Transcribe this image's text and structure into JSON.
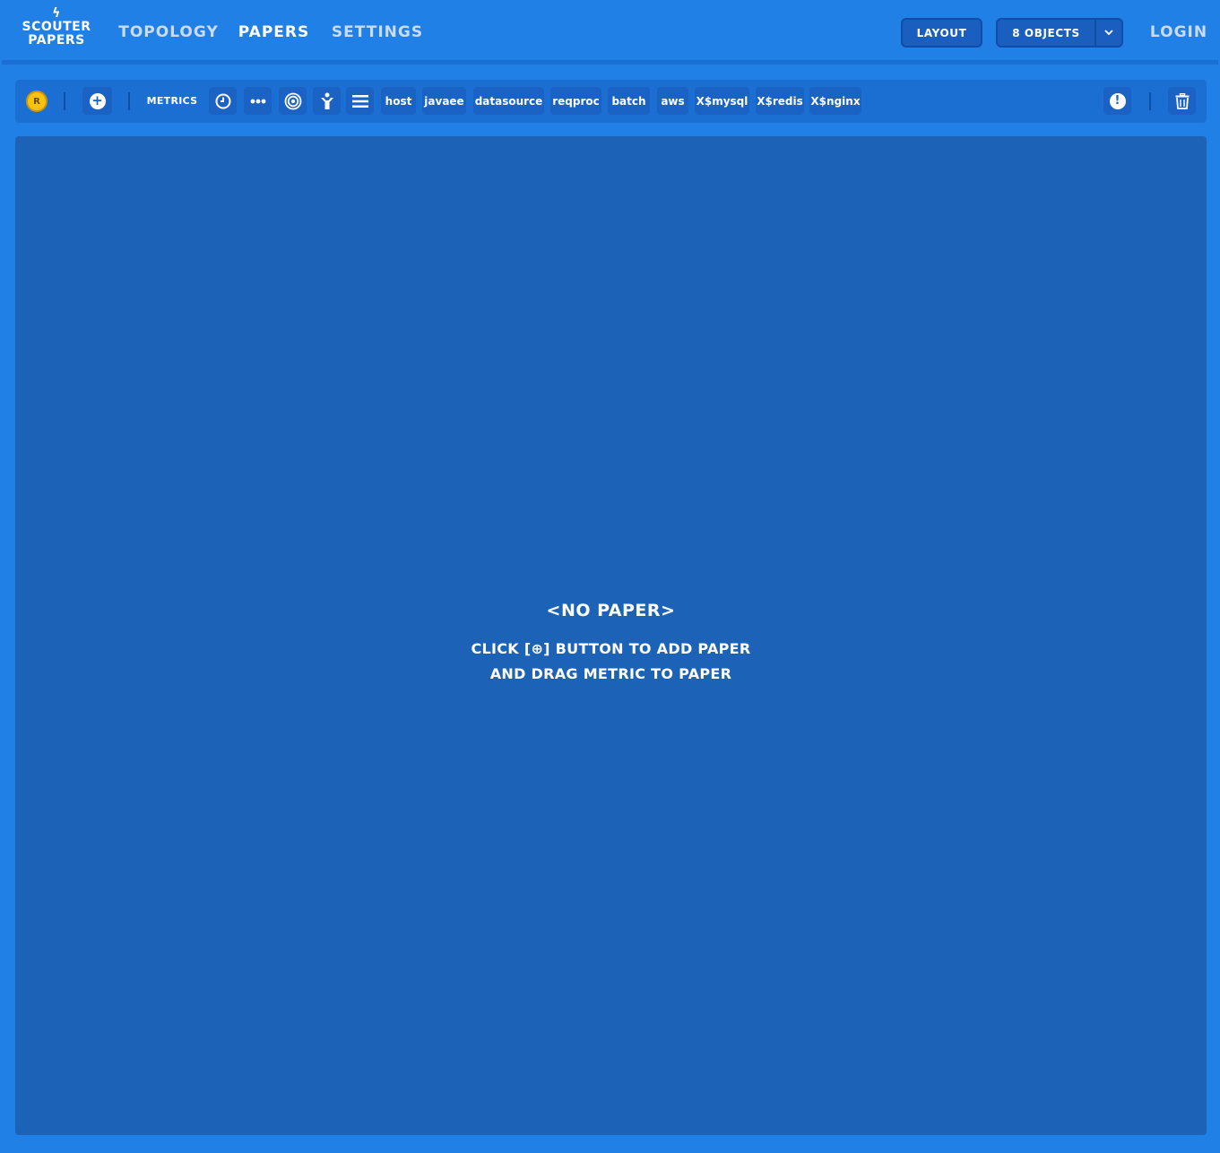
{
  "logo": {
    "bolt": "ϟ",
    "line1": "SCOUTER",
    "line2": "PAPERS"
  },
  "nav": {
    "tabs": [
      {
        "label": "TOPOLOGY"
      },
      {
        "label": "PAPERS"
      },
      {
        "label": "SETTINGS"
      }
    ],
    "layout_label": "LAYOUT",
    "objects_label": "8 OBJECTS",
    "objects_caret": "⌄",
    "login_label": "LOGIN"
  },
  "toolbar": {
    "realtime_badge": "R",
    "add_paper_glyph": "+",
    "metrics_label": "METRICS",
    "metric_chips": [
      "host",
      "javaee",
      "datasource",
      "reqproc",
      "batch",
      "aws",
      "X$mysql",
      "X$redis",
      "X$nginx"
    ],
    "alert_glyph": "!"
  },
  "empty_state": {
    "title": "<NO PAPER>",
    "line1": "CLICK [⊕] BUTTON TO ADD PAPER",
    "line2": "AND DRAG METRIC TO PAPER"
  },
  "colors": {
    "background": "#2080e6",
    "toolbar": "#1c6fd2",
    "content": "#1c63b8",
    "button": "#1a5fbf",
    "badge": "#f5c211"
  }
}
